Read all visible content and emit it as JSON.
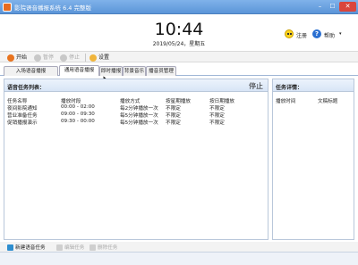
{
  "window": {
    "title": "影院语音播报系统 6.4 完整版",
    "min": "–",
    "max": "☐",
    "close": "✕"
  },
  "header": {
    "time": "10:44",
    "date": "2019/05/24，星期五",
    "register": "注册",
    "help": "帮助",
    "dropdown": "▾"
  },
  "toolbar": {
    "start": "开始",
    "pause": "暂停",
    "stop": "停止",
    "settings": "设置"
  },
  "tabs": [
    "入场语音播报",
    "通用语音播报",
    "即时播报",
    "背景音乐",
    "播音员管理"
  ],
  "task_list": {
    "title": "语音任务列表：",
    "status": "停止",
    "columns": [
      "任务名称",
      "播放时段",
      "播放方式",
      "按星期播放",
      "按日期播放"
    ],
    "rows": [
      [
        "夜间影院通知",
        "00:00 - 02:00",
        "每2分钟播放一次",
        "不限定",
        "不限定"
      ],
      [
        "营业准备任务",
        "09:00 - 09:30",
        "每5分钟播放一次",
        "不限定",
        "不限定"
      ],
      [
        "促销播报演示",
        "09:30 - 00:00",
        "每5分钟播放一次",
        "不限定",
        "不限定"
      ]
    ]
  },
  "task_detail": {
    "title": "任务详情：",
    "columns": [
      "播放时间",
      "文稿标题"
    ]
  },
  "bottom": {
    "new_task": "新建语音任务",
    "edit_task": "编辑任务",
    "delete_task": "删除任务"
  },
  "icons": [
    "app-icon",
    "smiley-icon",
    "help-icon",
    "play-icon",
    "pause-icon",
    "stop-icon",
    "settings-icon",
    "add-icon",
    "edit-icon",
    "delete-icon"
  ]
}
